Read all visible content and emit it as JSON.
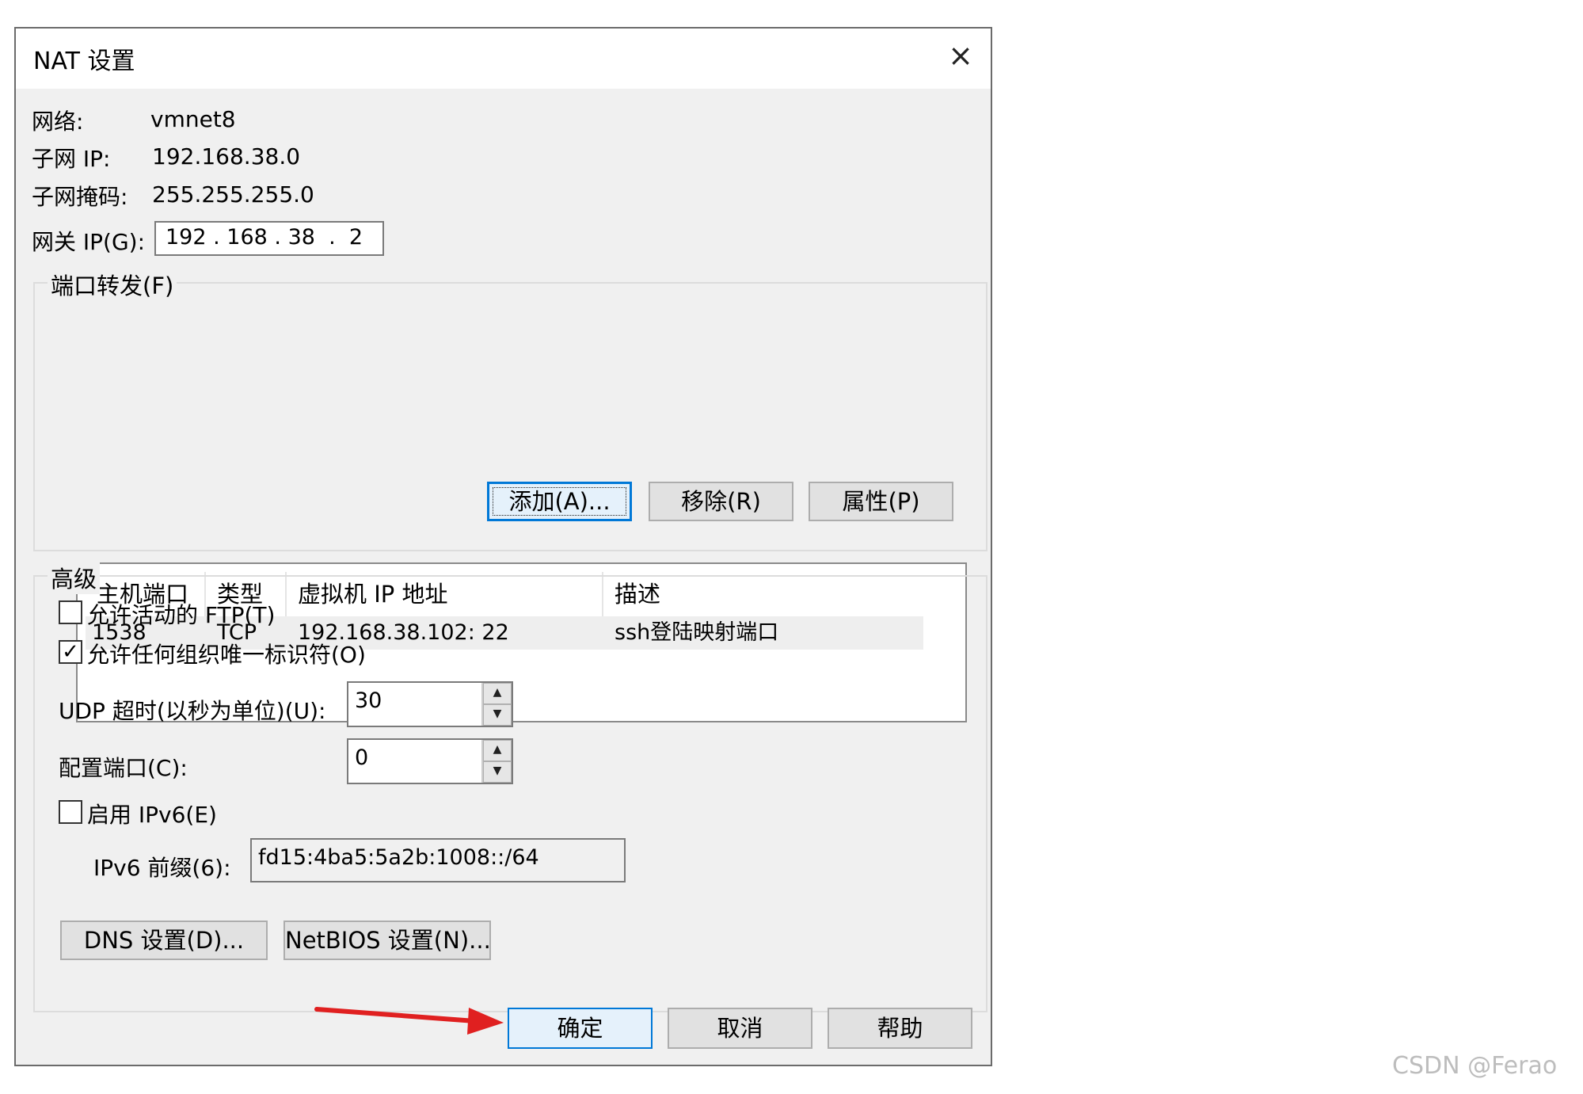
{
  "dialog": {
    "title": "NAT 设置",
    "close_icon": "×"
  },
  "info": {
    "network_label": "网络:",
    "network_value": "vmnet8",
    "subnet_ip_label": "子网 IP:",
    "subnet_ip_value": "192.168.38.0",
    "subnet_mask_label": "子网掩码:",
    "subnet_mask_value": "255.255.255.0",
    "gateway_label": "网关 IP(G):",
    "gateway_value": "192 . 168 . 38  .  2"
  },
  "port_forwarding": {
    "group_title": "端口转发(F)",
    "columns": [
      "主机端口",
      "类型",
      "虚拟机 IP 地址",
      "描述"
    ],
    "rows": [
      {
        "host_port": "1538",
        "type": "TCP",
        "vm_ip": "192.168.38.102: 22",
        "description": "ssh登陆映射端口"
      }
    ],
    "add_label": "添加(A)...",
    "remove_label": "移除(R)",
    "properties_label": "属性(P)"
  },
  "advanced": {
    "group_title": "高级",
    "allow_ftp_label": "允许活动的 FTP(T)",
    "allow_ftp_checked": false,
    "allow_oui_label": "允许任何组织唯一标识符(O)",
    "allow_oui_checked": true,
    "udp_timeout_label": "UDP 超时(以秒为单位)(U):",
    "udp_timeout_value": "30",
    "config_port_label": "配置端口(C):",
    "config_port_value": "0",
    "enable_ipv6_label": "启用 IPv6(E)",
    "enable_ipv6_checked": false,
    "ipv6_prefix_label": "IPv6 前缀(6):",
    "ipv6_prefix_value": "fd15:4ba5:5a2b:1008::/64",
    "dns_label": "DNS 设置(D)...",
    "netbios_label": "NetBIOS 设置(N)..."
  },
  "footer": {
    "ok_label": "确定",
    "cancel_label": "取消",
    "help_label": "帮助"
  },
  "annotation": {
    "arrow_color": "#e02020"
  },
  "watermark": "CSDN @Ferao"
}
